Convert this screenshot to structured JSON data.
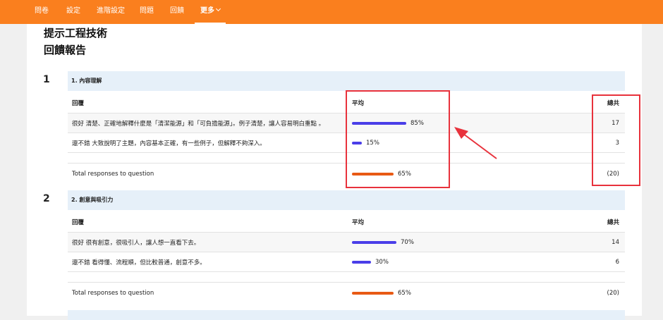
{
  "nav": {
    "items": [
      "問卷",
      "設定",
      "進階設定",
      "問題",
      "回饋"
    ],
    "more_label": "更多"
  },
  "page": {
    "title_line1": "提示工程技術",
    "title_line2": "回饋報告"
  },
  "questions": [
    {
      "number": "1",
      "title": "1. 內容理解",
      "headers": {
        "response": "回覆",
        "average": "平均",
        "total": "總共"
      },
      "rows": [
        {
          "label": "很好 清楚、正確地解釋什麼是「清潔能源」和「可負擔能源」。例子清楚，讓人容易明白重點 。",
          "percent_text": "85%",
          "percent": 85,
          "total": "17"
        },
        {
          "label": "還不錯 大致說明了主題，內容基本正確，有一些例子，但解釋不夠深入。",
          "percent_text": "15%",
          "percent": 15,
          "total": "3"
        }
      ],
      "summary": {
        "label": "Total responses to question",
        "percent_text": "65%",
        "percent": 65,
        "total": "(20)"
      }
    },
    {
      "number": "2",
      "title": "2. 創意與吸引力",
      "headers": {
        "response": "回覆",
        "average": "平均",
        "total": "總共"
      },
      "rows": [
        {
          "label": "很好 很有創意，很吸引人，讓人想一直看下去。",
          "percent_text": "70%",
          "percent": 70,
          "total": "14"
        },
        {
          "label": "還不錯 看得懂、流程順，但比較普通，創意不多。",
          "percent_text": "30%",
          "percent": 30,
          "total": "6"
        }
      ],
      "summary": {
        "label": "Total responses to question",
        "percent_text": "65%",
        "percent": 65,
        "total": "(20)"
      }
    }
  ],
  "colors": {
    "nav": "#fa7f1e",
    "bar_blue": "#4a3ee8",
    "bar_orange": "#e85a14",
    "annotation": "#e8323c",
    "question_header": "#e6f0f9"
  }
}
